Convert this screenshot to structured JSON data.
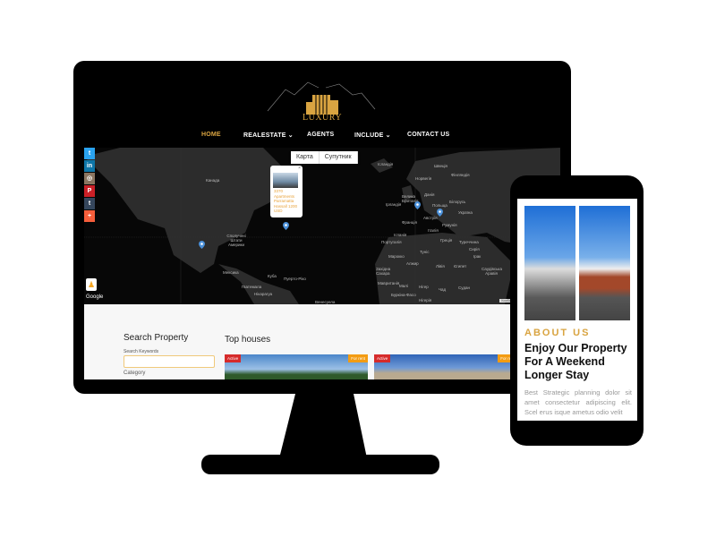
{
  "brand": {
    "logo_text": "LUXURY",
    "accent": "#d9a441"
  },
  "nav": {
    "items": [
      {
        "label": "HOME",
        "active": true
      },
      {
        "label": "REALESTATE",
        "has_dropdown": true
      },
      {
        "label": "AGENTS"
      },
      {
        "label": "INCLUDE",
        "has_dropdown": true
      },
      {
        "label": "CONTACT US"
      }
    ]
  },
  "social": [
    {
      "icon": "twitter-icon",
      "glyph": "t",
      "color": "#2aa3ef"
    },
    {
      "icon": "linkedin-icon",
      "glyph": "in",
      "color": "#0e76a8"
    },
    {
      "icon": "instagram-icon",
      "glyph": "◎",
      "color": "#8a7560"
    },
    {
      "icon": "pinterest-icon",
      "glyph": "P",
      "color": "#cb2027"
    },
    {
      "icon": "tumblr-icon",
      "glyph": "t",
      "color": "#35465c"
    },
    {
      "icon": "more-icon",
      "glyph": "+",
      "color": "#f65e3b"
    }
  ],
  "map": {
    "type_buttons": [
      "Карта",
      "Супутник"
    ],
    "popup_text": "3370 Apartments Parramatta Hassall 1200 USD",
    "google_label": "Google",
    "attribution": "Комбінації клавіш   Дані карт ©2020 Goo",
    "labels": [
      "Канада",
      "Сполучені Штати Америки",
      "Мексика",
      "Куба",
      "Гватемала",
      "Нікарагуа",
      "Пуерто-Ріко",
      "Ісландія",
      "Швеція",
      "Норвегія",
      "Фінляндія",
      "Велика Британія",
      "Данія",
      "Ірландія",
      "Польща",
      "Білорусь",
      "Україна",
      "Франція",
      "Австрія",
      "Румунія",
      "Іспанія",
      "Італія",
      "Португалія",
      "Греція",
      "Туреччина",
      "Туніс",
      "Марокко",
      "Алжир",
      "Лівія",
      "Єгипет",
      "Сирія",
      "Ірак",
      "Західна Сахара",
      "Мавританія",
      "Малі",
      "Нігер",
      "Чад",
      "Судан",
      "Буркіна-Фасо",
      "Нігерія",
      "Саудівська Аравія",
      "Венесуела"
    ]
  },
  "search": {
    "title": "Search Property",
    "keywords_label": "Search Keywords",
    "keywords_value": "",
    "category_label": "Category"
  },
  "top_houses": {
    "title": "Top houses",
    "cards": [
      {
        "status": "Active",
        "type": "For rent"
      },
      {
        "status": "Active",
        "type": "For rent"
      }
    ]
  },
  "mobile": {
    "eyebrow": "ABOUT US",
    "heading": "Enjoy Our Property For A Weekend Longer Stay",
    "body": "Best Strategic planning dolor sit amet consectetur adipiscing elit. Scel erus isque ametus odio velit"
  }
}
